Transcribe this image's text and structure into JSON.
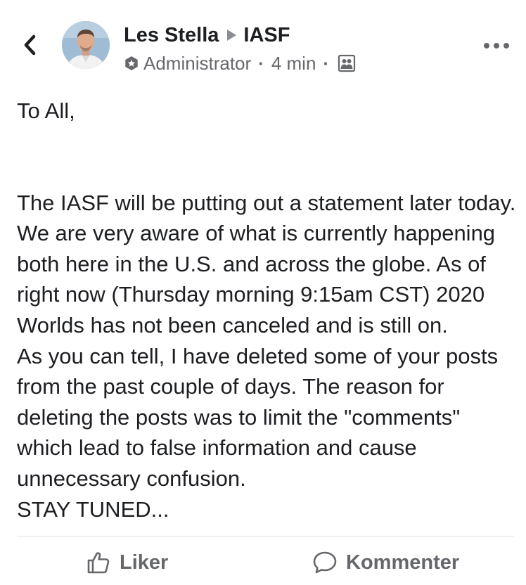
{
  "post": {
    "author": "Les Stella",
    "group": "IASF",
    "role": "Administrator",
    "time": "4 min",
    "separator": "·",
    "body": {
      "greeting": "To All,",
      "paragraph1": "The IASF will be putting out a statement later today. We are very aware of what is currently happening both here in the U.S. and across the globe. As of right now (Thursday morning 9:15am CST) 2020 Worlds has not been canceled and is still on.",
      "paragraph2": "As you can tell, I have deleted some of your posts from the past couple of days. The reason for deleting the posts was to limit the \"comments\" which lead to false information and cause unnecessary confusion.",
      "closing": "STAY TUNED..."
    }
  },
  "actions": {
    "like_label": "Liker",
    "comment_label": "Kommenter"
  },
  "icons": {
    "back": "chevron-left-icon",
    "more": "ellipsis-icon",
    "admin_badge": "admin-badge-icon",
    "audience": "group-icon",
    "like": "thumbs-up-icon",
    "comment": "speech-bubble-icon"
  },
  "colors": {
    "text": "#1c1e21",
    "secondary": "#65676b",
    "divider": "#dadde1"
  }
}
